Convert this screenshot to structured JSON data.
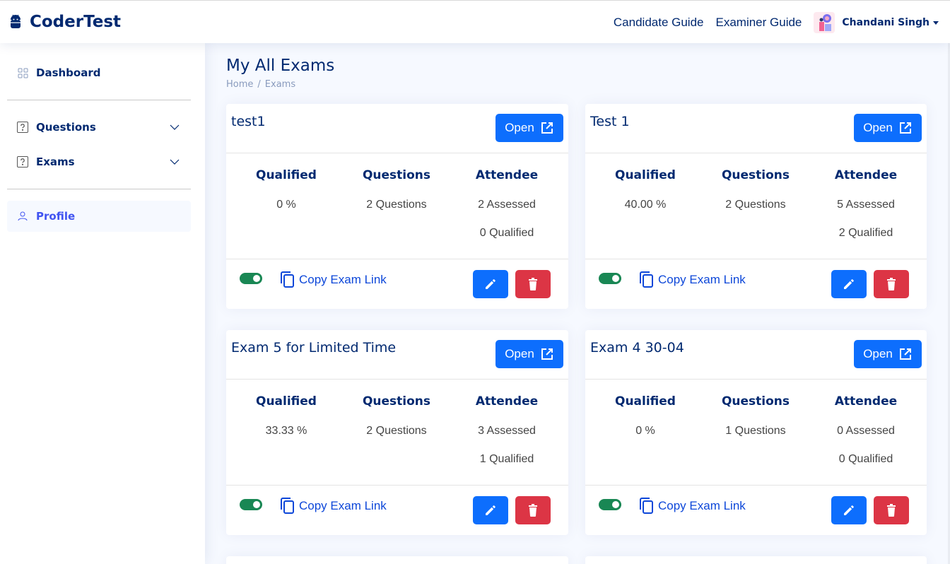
{
  "header": {
    "logo_text": "CoderTest",
    "nav": {
      "candidate_guide": "Candidate Guide",
      "examiner_guide": "Examiner Guide"
    },
    "user_name": "Chandani Singh"
  },
  "sidebar": {
    "items": [
      {
        "label": "Dashboard",
        "icon": "grid-icon"
      },
      {
        "label": "Questions",
        "icon": "question-square-icon"
      },
      {
        "label": "Exams",
        "icon": "question-square-icon"
      },
      {
        "label": "Profile",
        "icon": "person-icon",
        "active": true
      }
    ]
  },
  "page": {
    "title": "My All Exams",
    "breadcrumb": {
      "home": "Home",
      "separator": "/",
      "current": "Exams"
    }
  },
  "labels": {
    "open": "Open",
    "qualified": "Qualified",
    "questions": "Questions",
    "attendee": "Attendee",
    "copy_exam_link": "Copy Exam Link"
  },
  "exams": [
    {
      "title": "test1",
      "qualified": "0 %",
      "questions": "2 Questions",
      "assessed": "2 Assessed",
      "qualified_count": "0 Qualified",
      "enabled": true
    },
    {
      "title": "Test 1",
      "qualified": "40.00 %",
      "questions": "2 Questions",
      "assessed": "5 Assessed",
      "qualified_count": "2 Qualified",
      "enabled": true
    },
    {
      "title": "Exam 5 for Limited Time",
      "qualified": "33.33 %",
      "questions": "2 Questions",
      "assessed": "3 Assessed",
      "qualified_count": "1 Qualified",
      "enabled": true
    },
    {
      "title": "Exam 4 30-04",
      "qualified": "0 %",
      "questions": "1 Questions",
      "assessed": "0 Assessed",
      "qualified_count": "0 Qualified",
      "enabled": true
    }
  ],
  "colors": {
    "primary": "#0d6efd",
    "danger": "#dc3545",
    "success": "#198754",
    "navy": "#012970",
    "accent": "#4154f1"
  }
}
